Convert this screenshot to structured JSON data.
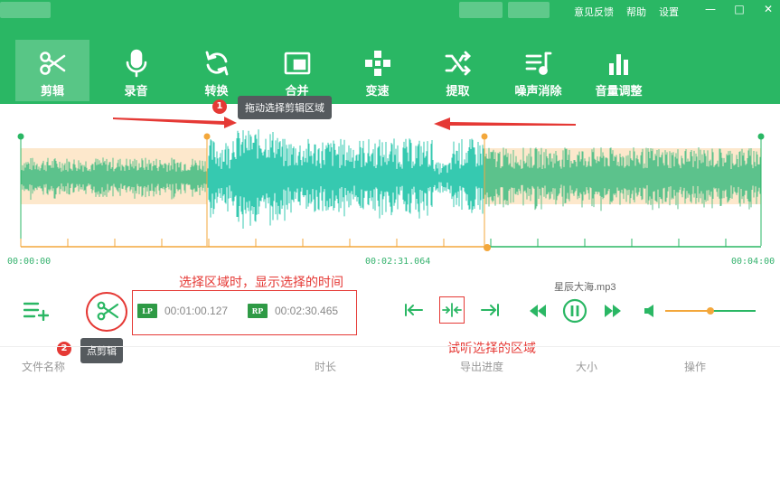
{
  "titlebar": {
    "links": [
      "意见反馈",
      "帮助",
      "设置"
    ],
    "window_buttons": [
      "minimize-icon",
      "maximize-icon",
      "close-icon"
    ]
  },
  "toolbar": {
    "items": [
      {
        "label": "剪辑",
        "icon": "scissors-icon",
        "active": true
      },
      {
        "label": "录音",
        "icon": "microphone-icon",
        "active": false
      },
      {
        "label": "转换",
        "icon": "refresh-icon",
        "active": false
      },
      {
        "label": "合并",
        "icon": "merge-icon",
        "active": false
      },
      {
        "label": "变速",
        "icon": "speed-icon",
        "active": false
      },
      {
        "label": "提取",
        "icon": "shuffle-icon",
        "active": false
      },
      {
        "label": "噪声消除",
        "icon": "noise-icon",
        "active": false
      },
      {
        "label": "音量调整",
        "icon": "volume-bars-icon",
        "active": false
      }
    ]
  },
  "annotations": {
    "drag_tip": "拖动选择剪辑区域",
    "drag_badge": "1",
    "cut_tip": "点剪辑",
    "cut_badge": "2",
    "selection_note": "选择区域时，显示选择的时间",
    "preview_note": "试听选择的区域"
  },
  "waveform": {
    "start_time": "00:00:00",
    "cursor_time": "00:02:31.064",
    "end_time": "00:04:00",
    "colors": {
      "wave_unselected": "#5cc28c",
      "wave_selected": "#36c9b0",
      "shade": "#fde8cc",
      "handle_green": "#2ab764",
      "handle_orange": "#f3a73b"
    }
  },
  "selection": {
    "lp_tag": "LP",
    "lp_time": "00:01:00.127",
    "rp_tag": "RP",
    "rp_time": "00:02:30.465"
  },
  "player": {
    "filename": "星辰大海.mp3",
    "volume_level": 0.5
  },
  "file_table": {
    "columns": [
      "文件名称",
      "时长",
      "导出进度",
      "大小",
      "操作"
    ]
  },
  "theme": {
    "brand_green": "#2ab764",
    "alert_red": "#e53935"
  }
}
